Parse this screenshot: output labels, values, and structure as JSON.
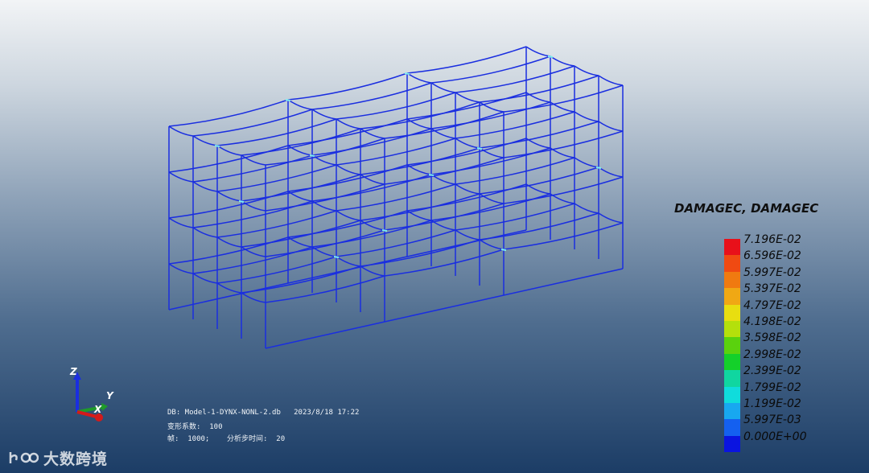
{
  "legend": {
    "title": "DAMAGEC, DAMAGEC",
    "labels": [
      "7.196E-02",
      "6.596E-02",
      "5.997E-02",
      "5.397E-02",
      "4.797E-02",
      "4.198E-02",
      "3.598E-02",
      "2.998E-02",
      "2.399E-02",
      "1.799E-02",
      "1.199E-02",
      "5.997E-03",
      "0.000E+00"
    ],
    "colors": [
      "#e8101a",
      "#f04a12",
      "#f07a10",
      "#f0a814",
      "#e8de10",
      "#b4e00c",
      "#5ad20e",
      "#14d02a",
      "#10d6a0",
      "#10dcdc",
      "#18a8f0",
      "#1460f0",
      "#0a14e0"
    ]
  },
  "info": {
    "db": "DB: Model-1-DYNX-NONL-2.db   2023/8/18 17:22",
    "scale": "变形系数:  100",
    "frame": "帧:  1000;    分析步时间:  20"
  },
  "triad": {
    "z": "Z",
    "y": "Y",
    "x": "X"
  },
  "watermark": {
    "text": "大数跨境"
  },
  "colors": {
    "frame": "#1a2ee0",
    "hotspot": "#7ef0f0"
  }
}
